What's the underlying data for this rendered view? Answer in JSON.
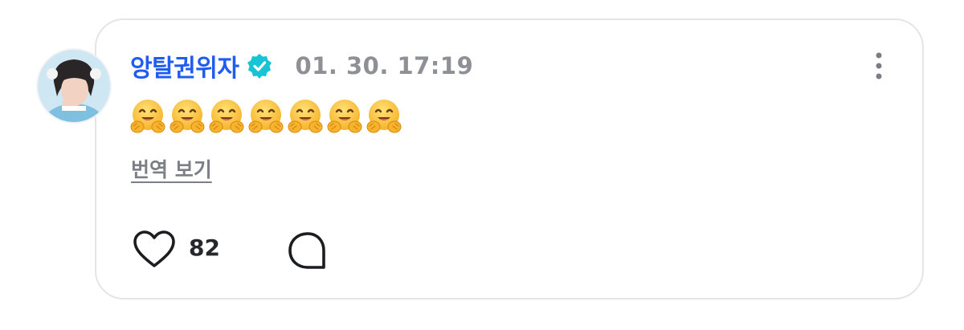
{
  "comment": {
    "author": {
      "name": "앙탈권위자",
      "verified_icon": "verified-badge-icon",
      "avatar": "user-avatar"
    },
    "timestamp": "01. 30. 17:19",
    "body_emoji": [
      "🤗",
      "🤗",
      "🤗",
      "🤗",
      "🤗",
      "🤗",
      "🤗"
    ],
    "translate_label": "번역 보기",
    "actions": {
      "like_icon": "heart-icon",
      "like_count": "82",
      "comment_icon": "comment-bubble-icon",
      "more_icon": "more-vertical-icon"
    },
    "colors": {
      "username": "#1f5cf0",
      "verified_badge": "#18c3d6",
      "timestamp": "#8e9096",
      "translate": "#7c7f86"
    }
  }
}
